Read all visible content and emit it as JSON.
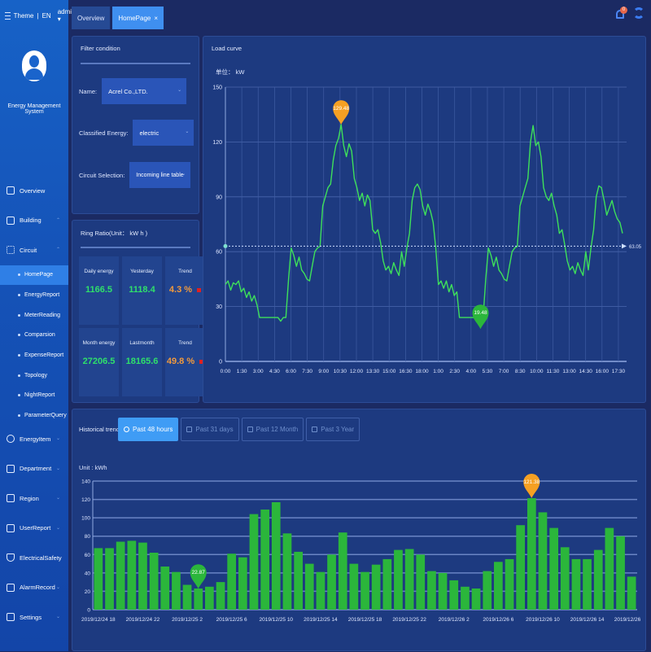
{
  "header": {
    "theme_label": "Theme",
    "lang_label": "EN",
    "user_label": "admin",
    "notification_count": "0",
    "tabs": [
      {
        "label": "Overview",
        "active": false
      },
      {
        "label": "HomePage",
        "active": true,
        "closable": true
      }
    ]
  },
  "sidebar": {
    "system_name": "Energy Management System",
    "items": [
      {
        "label": "Overview",
        "icon": "monitor-icon"
      },
      {
        "label": "Building",
        "icon": "building-icon",
        "chevron": true
      },
      {
        "label": "Circuit",
        "icon": "circuit-icon",
        "chevron": true,
        "children": [
          {
            "label": "HomePage",
            "active": true
          },
          {
            "label": "EnergyReport"
          },
          {
            "label": "MeterReading"
          },
          {
            "label": "Comparsion"
          },
          {
            "label": "ExpenseReport"
          },
          {
            "label": "Topology"
          },
          {
            "label": "NightReport"
          },
          {
            "label": "ParameterQuery"
          }
        ]
      },
      {
        "label": "EnergyItem",
        "icon": "energy-item-icon",
        "chevron": true
      },
      {
        "label": "Department",
        "icon": "department-icon",
        "chevron": true
      },
      {
        "label": "Region",
        "icon": "region-icon",
        "chevron": true
      },
      {
        "label": "UserReport",
        "icon": "user-report-icon",
        "chevron": true
      },
      {
        "label": "ElectricalSafety",
        "icon": "shield-check-icon",
        "chevron": true
      },
      {
        "label": "AlarmRecord",
        "icon": "alarm-record-icon",
        "chevron": true
      },
      {
        "label": "Settings",
        "icon": "settings-icon",
        "chevron": true
      }
    ]
  },
  "filter": {
    "title": "Filter condition",
    "name_label": "Name:",
    "name_value": "Acrel Co.,LTD.",
    "energy_label": "Classified Energy:",
    "energy_value": "electric",
    "circuit_label": "Circuit Selection:",
    "circuit_value": "Incoming line table"
  },
  "ring_ratio": {
    "title": "Ring Ratio(Unit： kW h )",
    "cells": [
      {
        "label": "Daily energy",
        "value": "1166.5",
        "color": "green"
      },
      {
        "label": "Yesterday",
        "value": "1118.4",
        "color": "green"
      },
      {
        "label": "Trend",
        "value": "4.3 %",
        "color": "orange",
        "trend": "up"
      },
      {
        "label": "Month energy",
        "value": "27206.5",
        "color": "green"
      },
      {
        "label": "Lastmonth",
        "value": "18165.6",
        "color": "green"
      },
      {
        "label": "Trend",
        "value": "49.8 %",
        "color": "orange",
        "trend": "up"
      }
    ]
  },
  "historical": {
    "title": "Historical trend",
    "buttons": [
      {
        "label": "Past 48 hours",
        "active": true
      },
      {
        "label": "Past 31 days",
        "active": false
      },
      {
        "label": "Past 12 Month",
        "active": false
      },
      {
        "label": "Past 3 Year",
        "active": false
      }
    ]
  },
  "colors": {
    "line": "#3ee05a",
    "bar": "#2bb63b",
    "max_marker": "#f5a023",
    "min_marker": "#2bb63b",
    "grid": "#5b78bd"
  },
  "chart_data": [
    {
      "type": "line",
      "title": "Load curve",
      "ylabel": "单位： kW",
      "ylim": [
        0,
        150
      ],
      "yticks": [
        0,
        30,
        60,
        90,
        120,
        150
      ],
      "xticks": [
        "0:00",
        "1:30",
        "3:00",
        "4:30",
        "6:00",
        "7:30",
        "9:00",
        "10:30",
        "12:00",
        "13:30",
        "15:00",
        "16:30",
        "18:00",
        "1:00",
        "2:30",
        "4:00",
        "5:30",
        "7:00",
        "8:30",
        "10:00",
        "11:30",
        "13:00",
        "14:30",
        "16:00",
        "17:30"
      ],
      "grid": true,
      "average_line": {
        "value": 63.05,
        "label": "63.05"
      },
      "max_marker": {
        "value": 129.48,
        "label": "129.48"
      },
      "min_marker": {
        "value": 19.48,
        "label": "19.48"
      },
      "values": [
        42,
        44,
        39,
        43,
        42,
        44,
        38,
        40,
        35,
        38,
        33,
        36,
        31,
        24,
        24,
        24,
        24,
        24,
        24,
        24,
        24,
        22,
        24,
        24,
        45,
        62,
        58,
        52,
        57,
        50,
        48,
        45,
        44,
        52,
        60,
        62,
        63,
        85,
        90,
        95,
        97,
        110,
        118,
        122,
        129.48,
        118,
        112,
        119,
        115,
        100,
        95,
        88,
        92,
        85,
        91,
        88,
        72,
        70,
        72,
        65,
        55,
        50,
        52,
        48,
        54,
        50,
        47,
        60,
        52,
        62,
        70,
        88,
        95,
        97,
        94,
        85,
        80,
        86,
        82,
        76,
        62,
        42,
        44,
        40,
        44,
        38,
        42,
        36,
        38,
        24,
        24,
        24,
        24,
        24,
        24,
        24,
        22,
        20,
        24,
        45,
        62,
        58,
        52,
        57,
        50,
        48,
        45,
        44,
        52,
        60,
        62,
        63,
        85,
        90,
        95,
        100,
        120,
        129,
        118,
        120,
        112,
        95,
        90,
        88,
        92,
        85,
        80,
        70,
        72,
        64,
        55,
        50,
        52,
        48,
        54,
        50,
        47,
        60,
        50,
        62,
        72,
        90,
        96,
        95,
        88,
        80,
        84,
        88,
        82,
        78,
        76,
        70
      ]
    },
    {
      "type": "bar",
      "title": "Historical trend",
      "ylabel": "Unit : kWh",
      "ylim": [
        0,
        140
      ],
      "yticks": [
        0,
        20,
        40,
        60,
        80,
        100,
        120,
        140
      ],
      "xticks": [
        "2019/12/24 18",
        "2019/12/24 22",
        "2019/12/25 2",
        "2019/12/25 6",
        "2019/12/25 10",
        "2019/12/25 14",
        "2019/12/25 18",
        "2019/12/25 22",
        "2019/12/26 2",
        "2019/12/26 6",
        "2019/12/26 10",
        "2019/12/26 14",
        "2019/12/26"
      ],
      "xtick_every": 4,
      "grid": true,
      "max_marker": {
        "index": 41,
        "value": 121.38,
        "label": "121.38"
      },
      "min_marker": {
        "index": 30,
        "value": 22.87,
        "label": "22.87"
      },
      "values": [
        67,
        67,
        74,
        75,
        73,
        62,
        47,
        41,
        27,
        23,
        25,
        30,
        61,
        57,
        104,
        109,
        117,
        83,
        63,
        50,
        41,
        60,
        84,
        50,
        41,
        49,
        55,
        65,
        66,
        60,
        42,
        40,
        32,
        25,
        23,
        42,
        52,
        55,
        92,
        121.38,
        106,
        89,
        68,
        55,
        55,
        65,
        89,
        80,
        36
      ]
    }
  ]
}
